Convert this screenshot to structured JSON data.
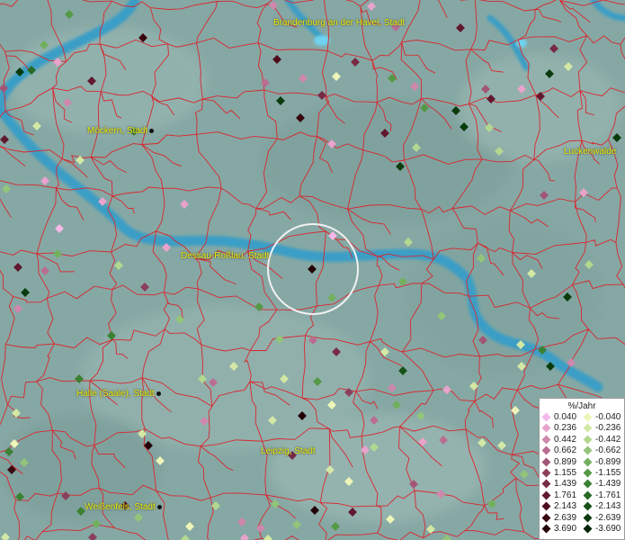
{
  "map": {
    "legend": {
      "title": "%/Jahr",
      "positive": [
        {
          "label": "0.040",
          "color": "#f5b8e8"
        },
        {
          "label": "0.236",
          "color": "#e8a3cc"
        },
        {
          "label": "0.442",
          "color": "#cf87ad"
        },
        {
          "label": "0.662",
          "color": "#b96d91"
        },
        {
          "label": "0.899",
          "color": "#a25576"
        },
        {
          "label": "1.155",
          "color": "#8c3f5c"
        },
        {
          "label": "1.439",
          "color": "#772a44"
        },
        {
          "label": "1.761",
          "color": "#62182f"
        },
        {
          "label": "2.143",
          "color": "#4d0a1c"
        },
        {
          "label": "2.639",
          "color": "#38040e"
        },
        {
          "label": "3.690",
          "color": "#230005"
        }
      ],
      "negative": [
        {
          "label": "-0.040",
          "color": "#eef5b8"
        },
        {
          "label": "-0.236",
          "color": "#d2e8a4"
        },
        {
          "label": "-0.442",
          "color": "#b3d88f"
        },
        {
          "label": "-0.662",
          "color": "#92c577"
        },
        {
          "label": "-0.899",
          "color": "#72b05e"
        },
        {
          "label": "-1.155",
          "color": "#549946"
        },
        {
          "label": "-1.439",
          "color": "#3b8133"
        },
        {
          "label": "-1.761",
          "color": "#266a24"
        },
        {
          "label": "-2.143",
          "color": "#155218"
        },
        {
          "label": "-2.639",
          "color": "#093b0d"
        },
        {
          "label": "-3.690",
          "color": "#022405"
        }
      ]
    },
    "cities": [
      {
        "name": "Brandenburg an der Havel, Stadt"
      },
      {
        "name": "Möckern, Stadt"
      },
      {
        "name": "Luckenwalde"
      },
      {
        "name": "Dessau-Roßlau, Stadt"
      },
      {
        "name": "Halle (Saale), Stadt"
      },
      {
        "name": "Leipzig, Stadt"
      },
      {
        "name": "Weißenfels, Stadt"
      }
    ],
    "colors": {
      "terrain": "#86a8a4",
      "river": "#3a9ec6",
      "border": "#d9262e",
      "city_label": "#e8f000"
    }
  }
}
